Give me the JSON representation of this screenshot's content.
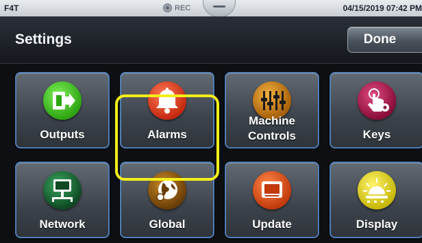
{
  "status_bar": {
    "device": "F4T",
    "rec_label": "REC",
    "datetime": "04/15/2019 07:42 PM"
  },
  "header": {
    "title": "Settings",
    "done_label": "Done"
  },
  "tiles": [
    {
      "label": "Outputs",
      "icon": "outputs-icon",
      "color": "#3fbf1f"
    },
    {
      "label": "Alarms",
      "icon": "bell-icon",
      "color": "#d93a1e"
    },
    {
      "label_line1": "Machine",
      "label_line2": "Controls",
      "icon": "sliders-icon",
      "color": "#c77a12"
    },
    {
      "label": "Keys",
      "icon": "touch-key-icon",
      "color": "#b01a52"
    },
    {
      "label": "Network",
      "icon": "network-icon",
      "color": "#1f6b3a"
    },
    {
      "label": "Global",
      "icon": "globe-icon",
      "color": "#8a5a10",
      "highlighted": true
    },
    {
      "label": "Update",
      "icon": "update-icon",
      "color": "#d8501a"
    },
    {
      "label": "Display",
      "icon": "display-icon",
      "color": "#e2d418"
    }
  ],
  "colors": {
    "tile_border": "#4f7fb6",
    "highlight": "#f4ef1a"
  }
}
